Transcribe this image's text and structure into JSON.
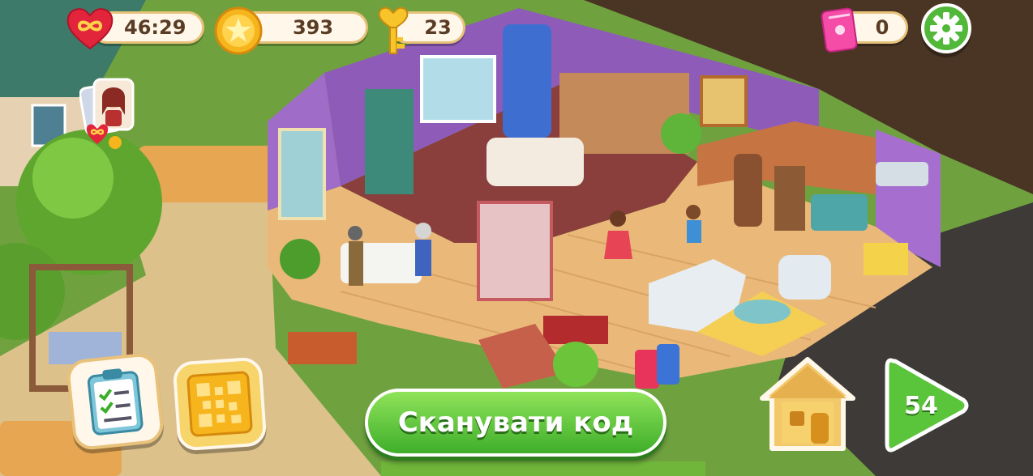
{
  "hud": {
    "lives_timer": "46:29",
    "coins": "393",
    "keys": "23",
    "tickets": "0"
  },
  "buttons": {
    "scan_code_label": "Сканувати код",
    "level_number": "54"
  },
  "icons": {
    "lives": "infinite-heart-icon",
    "coins": "star-coin-icon",
    "keys": "heart-key-icon",
    "tickets": "pink-ticket-icon",
    "settings": "gear-icon",
    "tasks": "clipboard-tasks-icon",
    "scan": "qr-code-icon",
    "home": "house-icon",
    "play": "play-triangle-icon",
    "profile": "character-avatar-icon"
  },
  "colors": {
    "accent_green": "#4caf2f",
    "panel_cream": "#fff7ea",
    "coin_gold": "#f6b51c",
    "heart_red": "#e2253a",
    "ticket_pink": "#f54ca8"
  }
}
